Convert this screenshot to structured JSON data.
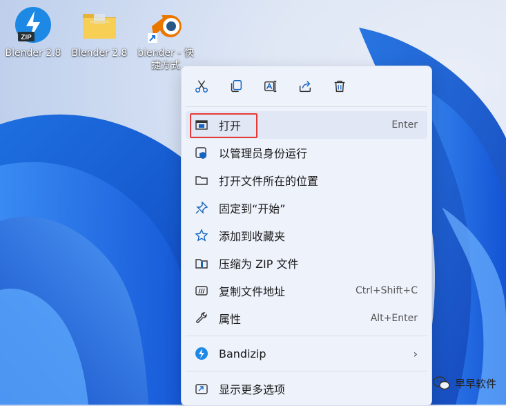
{
  "desktop": {
    "icons": [
      {
        "label_line1": "Blender 2.8",
        "label_line2": "",
        "icon": "zip-archive-icon"
      },
      {
        "label_line1": "Blender 2.8",
        "label_line2": "",
        "icon": "folder-icon"
      },
      {
        "label_line1": "blender - 快",
        "label_line2": "捷方式",
        "icon": "blender-shortcut-icon"
      }
    ]
  },
  "menu": {
    "toolbar": [
      {
        "name": "cut",
        "icon": "scissors-icon"
      },
      {
        "name": "copy",
        "icon": "copy-icon"
      },
      {
        "name": "rename",
        "icon": "rename-icon"
      },
      {
        "name": "share",
        "icon": "share-icon"
      },
      {
        "name": "delete",
        "icon": "trash-icon"
      }
    ],
    "items": [
      {
        "label": "打开",
        "shortcut": "Enter",
        "icon": "open-window-icon"
      },
      {
        "label": "以管理员身份运行",
        "shortcut": "",
        "icon": "admin-shield-icon"
      },
      {
        "label": "打开文件所在的位置",
        "shortcut": "",
        "icon": "folder-outline-icon"
      },
      {
        "label": "固定到“开始”",
        "shortcut": "",
        "icon": "pin-icon"
      },
      {
        "label": "添加到收藏夹",
        "shortcut": "",
        "icon": "star-icon"
      },
      {
        "label": "压缩为 ZIP 文件",
        "shortcut": "",
        "icon": "zip-folder-icon"
      },
      {
        "label": "复制文件地址",
        "shortcut": "Ctrl+Shift+C",
        "icon": "copy-path-icon"
      },
      {
        "label": "属性",
        "shortcut": "Alt+Enter",
        "icon": "wrench-icon"
      }
    ],
    "bandizip": {
      "label": "Bandizip",
      "icon": "bandizip-icon",
      "chevron": "›"
    },
    "more": {
      "label": "显示更多选项",
      "icon": "more-options-icon"
    }
  },
  "watermark": {
    "text": "早早软件",
    "icon": "wechat-icon"
  },
  "colors": {
    "accent": "#0067c0",
    "highlight_border": "#e53935",
    "menu_bg": "#eef2fb"
  }
}
